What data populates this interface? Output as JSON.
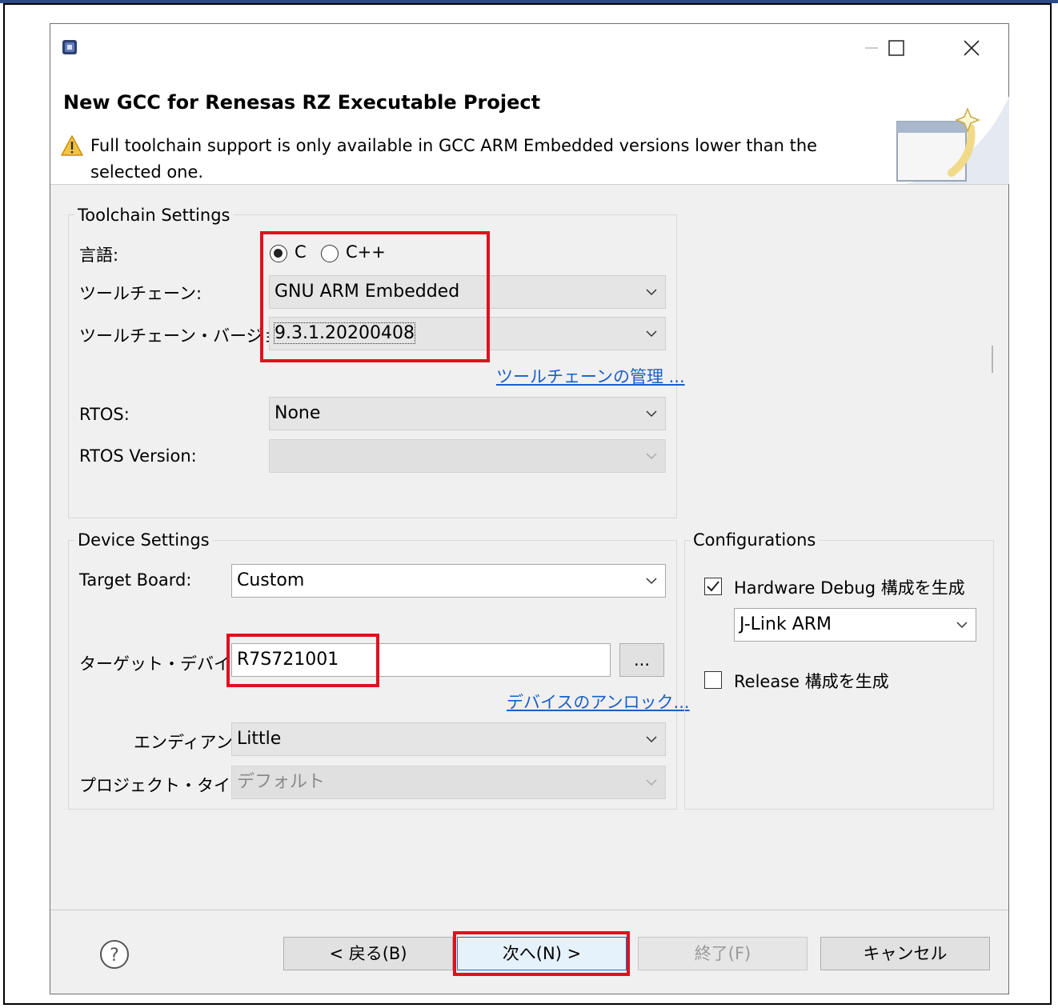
{
  "dialog": {
    "title": "New GCC for Renesas RZ Executable Project",
    "warning": "Full toolchain support is only available in GCC ARM Embedded versions lower than the selected one."
  },
  "window_controls": {
    "minimize": "—",
    "maximize": "☐",
    "close": "✕"
  },
  "toolchain_settings": {
    "group_title": "Toolchain Settings",
    "language_label": "言語:",
    "language_options": [
      "C",
      "C++"
    ],
    "language_selected": "C",
    "toolchain_label": "ツールチェーン:",
    "toolchain_value": "GNU ARM Embedded",
    "toolchain_version_label": "ツールチェーン・バージョン:",
    "toolchain_version_value": "9.3.1.20200408",
    "manage_toolchains_link": "ツールチェーンの管理 ...",
    "rtos_label": "RTOS:",
    "rtos_value": "None",
    "rtos_version_label": "RTOS Version:",
    "rtos_version_value": ""
  },
  "device_settings": {
    "group_title": "Device Settings",
    "target_board_label": "Target Board:",
    "target_board_value": "Custom",
    "target_device_label": "ターゲット・デバイス:",
    "target_device_value": "R7S721001",
    "browse_button": "...",
    "unlock_devices_link": "デバイスのアンロック...",
    "endian_label": "エンディアン:",
    "endian_value": "Little",
    "project_type_label": "プロジェクト・タイプ:",
    "project_type_value": "デフォルト"
  },
  "configurations": {
    "group_title": "Configurations",
    "hardware_debug_label": "Hardware Debug 構成を生成",
    "hardware_debug_checked": true,
    "debugger_value": "J-Link ARM",
    "release_label": "Release 構成を生成",
    "release_checked": false
  },
  "buttons": {
    "back": "< 戻る(B)",
    "next": "次へ(N) >",
    "finish": "終了(F)",
    "cancel": "キャンセル"
  },
  "colors": {
    "highlight": "#e0101e",
    "link": "#1a5fc8",
    "dialog_bg": "#f0f0f0"
  }
}
